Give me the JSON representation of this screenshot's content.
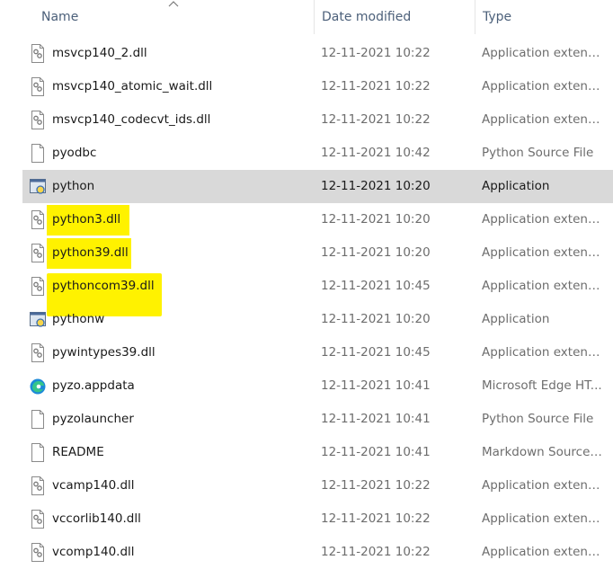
{
  "columns": {
    "name": "Name",
    "date": "Date modified",
    "type": "Type"
  },
  "icons": {
    "dll": "dll-gear-file-icon",
    "blank": "blank-file-icon",
    "python_exe": "python-app-icon",
    "edge": "edge-browser-icon"
  },
  "highlight_color": "#fff200",
  "files": [
    {
      "name": "msvcp140_2.dll",
      "date": "12-11-2021 10:22",
      "type": "Application extens...",
      "icon": "dll"
    },
    {
      "name": "msvcp140_atomic_wait.dll",
      "date": "12-11-2021 10:22",
      "type": "Application extens...",
      "icon": "dll"
    },
    {
      "name": "msvcp140_codecvt_ids.dll",
      "date": "12-11-2021 10:22",
      "type": "Application extens...",
      "icon": "dll"
    },
    {
      "name": "pyodbc",
      "date": "12-11-2021 10:42",
      "type": "Python Source File",
      "icon": "blank"
    },
    {
      "name": "python",
      "date": "12-11-2021 10:20",
      "type": "Application",
      "icon": "python_exe",
      "selected": true
    },
    {
      "name": "python3.dll",
      "date": "12-11-2021 10:20",
      "type": "Application extens...",
      "icon": "dll",
      "highlighted": true
    },
    {
      "name": "python39.dll",
      "date": "12-11-2021 10:20",
      "type": "Application extens...",
      "icon": "dll",
      "highlighted": true
    },
    {
      "name": "pythoncom39.dll",
      "date": "12-11-2021 10:45",
      "type": "Application extens...",
      "icon": "dll",
      "highlighted": true
    },
    {
      "name": "pythonw",
      "date": "12-11-2021 10:20",
      "type": "Application",
      "icon": "python_exe"
    },
    {
      "name": "pywintypes39.dll",
      "date": "12-11-2021 10:45",
      "type": "Application extens...",
      "icon": "dll"
    },
    {
      "name": "pyzo.appdata",
      "date": "12-11-2021 10:41",
      "type": "Microsoft Edge HT...",
      "icon": "edge"
    },
    {
      "name": "pyzolauncher",
      "date": "12-11-2021 10:41",
      "type": "Python Source File",
      "icon": "blank"
    },
    {
      "name": "README",
      "date": "12-11-2021 10:41",
      "type": "Markdown Source ...",
      "icon": "blank"
    },
    {
      "name": "vcamp140.dll",
      "date": "12-11-2021 10:22",
      "type": "Application extens...",
      "icon": "dll"
    },
    {
      "name": "vccorlib140.dll",
      "date": "12-11-2021 10:22",
      "type": "Application extens...",
      "icon": "dll"
    },
    {
      "name": "vcomp140.dll",
      "date": "12-11-2021 10:22",
      "type": "Application extens...",
      "icon": "dll"
    }
  ]
}
